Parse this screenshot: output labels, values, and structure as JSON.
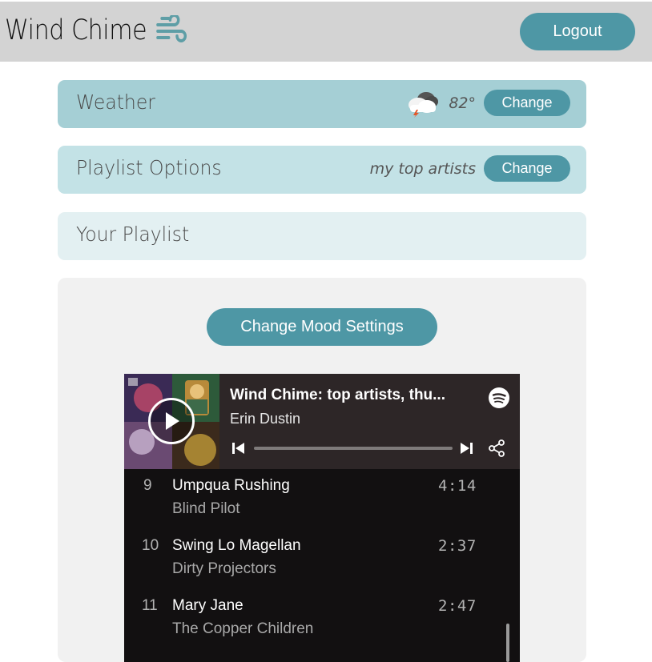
{
  "app": {
    "title": "Wind Chime",
    "logout_label": "Logout"
  },
  "cards": {
    "weather": {
      "title": "Weather",
      "temperature": "82°",
      "icon": "thunderstorm-cloud-icon",
      "change_label": "Change"
    },
    "playlist_options": {
      "title": "Playlist Options",
      "value": "my top artists",
      "change_label": "Change"
    },
    "your_playlist": {
      "title": "Your Playlist"
    }
  },
  "mood": {
    "button_label": "Change Mood Settings"
  },
  "player": {
    "playlist_title": "Wind Chime: top artists, thu...",
    "owner": "Erin Dustin",
    "tracks": [
      {
        "num": "9",
        "name": "Umpqua Rushing",
        "artist": "Blind Pilot",
        "duration": "4:14"
      },
      {
        "num": "10",
        "name": "Swing Lo Magellan",
        "artist": "Dirty Projectors",
        "duration": "2:37"
      },
      {
        "num": "11",
        "name": "Mary Jane",
        "artist": "The Copper Children",
        "duration": "2:47"
      }
    ]
  },
  "colors": {
    "header_bg": "#d3d3d3",
    "button": "#4e97a5",
    "weather_card": "#a5cfd5",
    "options_card": "#c3e2e6",
    "playlist_card": "#e3f0f2",
    "panel_bg": "#f1f1f1",
    "player_bg": "#121011",
    "player_header": "#2d2627"
  }
}
